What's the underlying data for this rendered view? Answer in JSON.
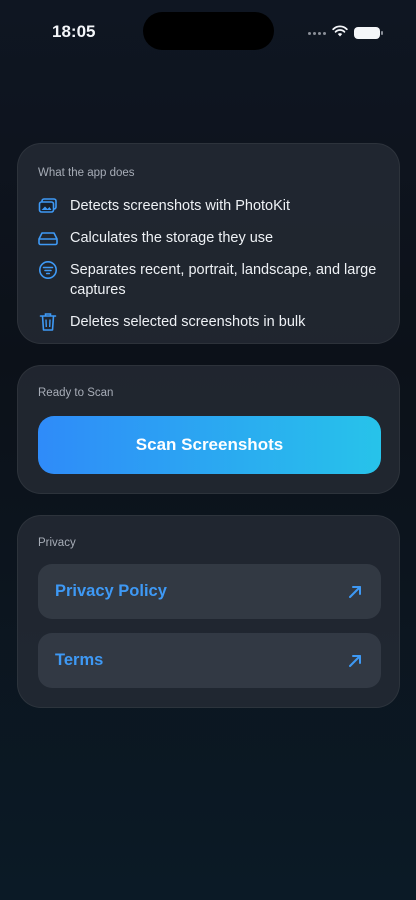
{
  "status": {
    "time": "18:05"
  },
  "features_card": {
    "title": "What the app does",
    "items": [
      {
        "icon": "photo-stack-icon",
        "text": "Detects screenshots with PhotoKit"
      },
      {
        "icon": "drive-icon",
        "text": "Calculates the storage they use"
      },
      {
        "icon": "filter-icon",
        "text": "Separates recent, portrait, landscape, and large captures"
      },
      {
        "icon": "trash-icon",
        "text": "Deletes selected screenshots in bulk"
      }
    ]
  },
  "scan_card": {
    "title": "Ready to Scan",
    "button_label": "Scan Screenshots"
  },
  "privacy_card": {
    "title": "Privacy",
    "links": [
      {
        "label": "Privacy Policy",
        "icon": "arrow-up-right-icon"
      },
      {
        "label": "Terms",
        "icon": "arrow-up-right-icon"
      }
    ]
  },
  "colors": {
    "accent": "#3e99f5",
    "button_gradient_start": "#2f8bf9",
    "button_gradient_end": "#27c3ea",
    "card_bg": "#282e38"
  }
}
